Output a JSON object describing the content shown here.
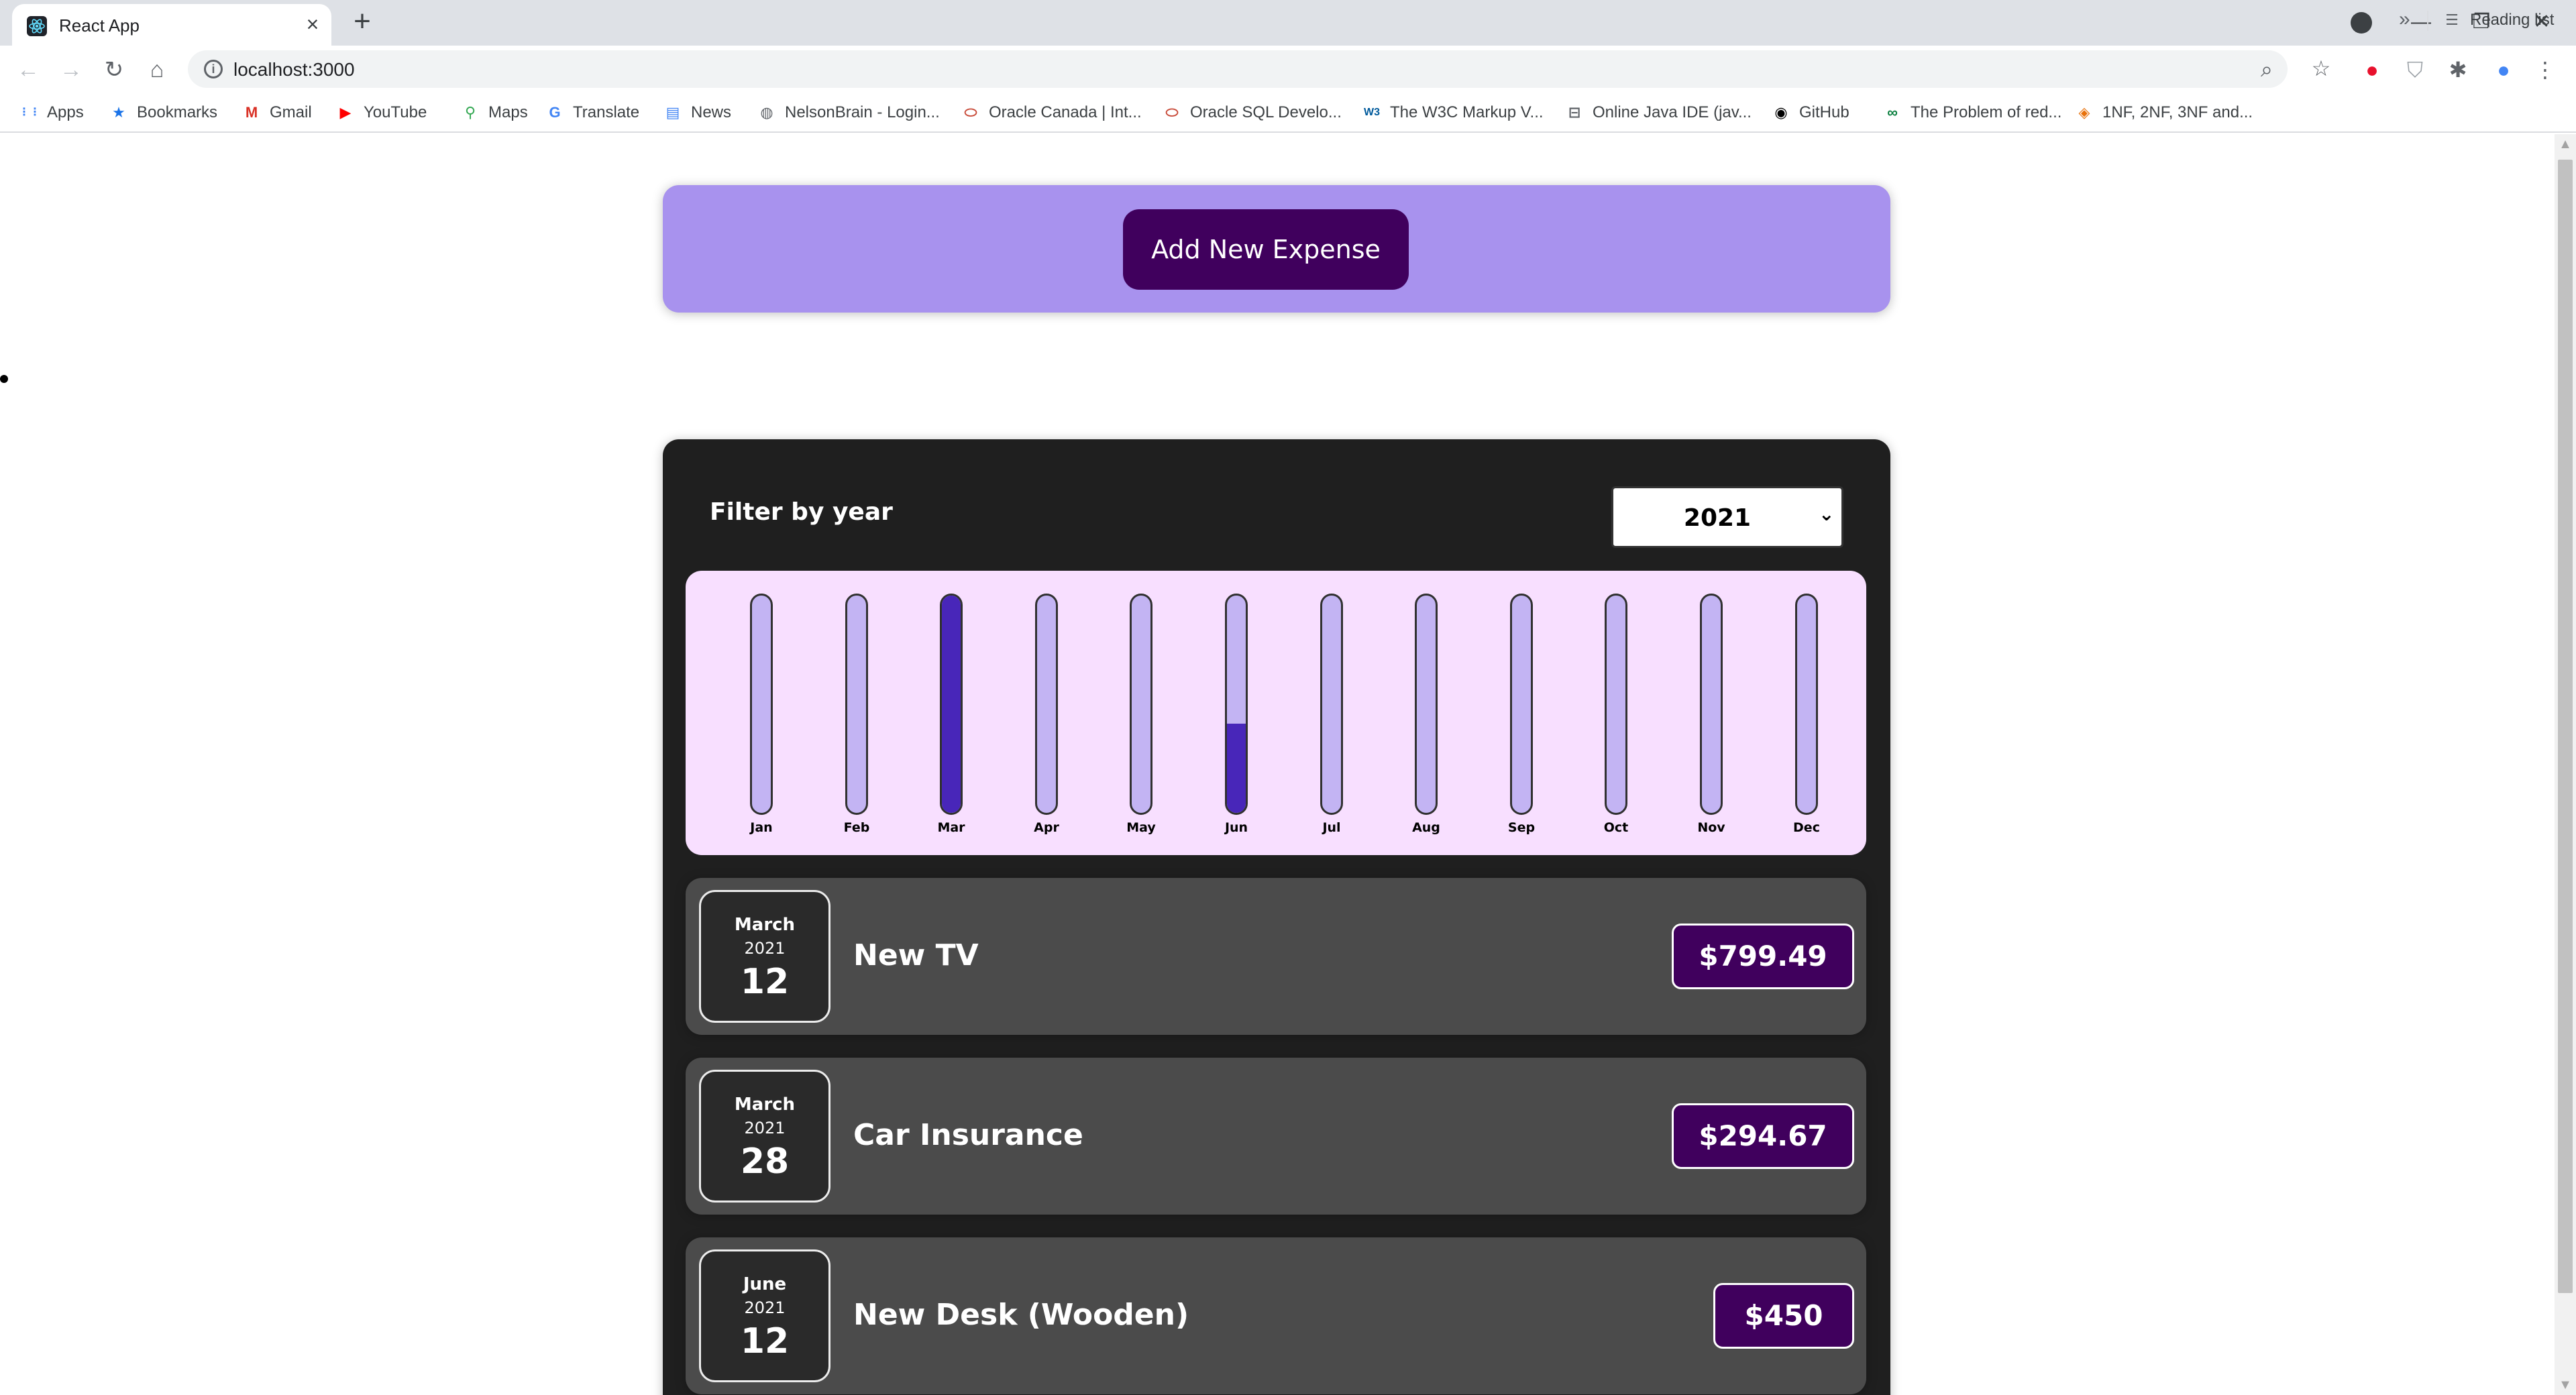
{
  "browser": {
    "tab_title": "React App",
    "url": "localhost:3000",
    "bookmarks": [
      {
        "label": "Apps",
        "icon": "apps-grid-icon",
        "color": "#4285f4"
      },
      {
        "label": "Bookmarks",
        "icon": "star-icon",
        "color": "#1a73e8"
      },
      {
        "label": "Gmail",
        "icon": "gmail-icon",
        "color": "#d93025"
      },
      {
        "label": "YouTube",
        "icon": "youtube-icon",
        "color": "#ff0000"
      },
      {
        "label": "Maps",
        "icon": "maps-pin-icon",
        "color": "#34a853"
      },
      {
        "label": "Translate",
        "icon": "translate-icon",
        "color": "#4285f4"
      },
      {
        "label": "News",
        "icon": "news-icon",
        "color": "#4285f4"
      },
      {
        "label": "NelsonBrain - Login...",
        "icon": "globe-icon",
        "color": "#5f6368"
      },
      {
        "label": "Oracle Canada | Int...",
        "icon": "oracle-icon",
        "color": "#c74634"
      },
      {
        "label": "Oracle SQL Develo...",
        "icon": "oracle-icon",
        "color": "#c74634"
      },
      {
        "label": "The W3C Markup V...",
        "icon": "w3c-icon",
        "color": "#005a9c"
      },
      {
        "label": "Online Java IDE (jav...",
        "icon": "java-icon",
        "color": "#5f6368"
      },
      {
        "label": "GitHub",
        "icon": "github-icon",
        "color": "#000000"
      },
      {
        "label": "The Problem of red...",
        "icon": "link-icon",
        "color": "#0a7f3f"
      },
      {
        "label": "1NF, 2NF, 3NF and...",
        "icon": "site-icon",
        "color": "#e8710a"
      }
    ],
    "reading_list": "Reading list"
  },
  "new_expense": {
    "button_label": "Add New Expense"
  },
  "filter": {
    "label": "Filter by year",
    "selected_year": "2021"
  },
  "chart_data": {
    "type": "bar",
    "categories": [
      "Jan",
      "Feb",
      "Mar",
      "Apr",
      "May",
      "Jun",
      "Jul",
      "Aug",
      "Sep",
      "Oct",
      "Nov",
      "Dec"
    ],
    "values": [
      0,
      0,
      1094.16,
      0,
      0,
      450,
      0,
      0,
      0,
      0,
      0,
      0
    ],
    "max": 1094.16,
    "fill_color": "#4826b9",
    "empty_color": "#c3b4f3"
  },
  "expenses": [
    {
      "month": "March",
      "year": "2021",
      "day": "12",
      "title": "New TV",
      "amount": "$799.49"
    },
    {
      "month": "March",
      "year": "2021",
      "day": "28",
      "title": "Car Insurance",
      "amount": "$294.67"
    },
    {
      "month": "June",
      "year": "2021",
      "day": "12",
      "title": "New Desk (Wooden)",
      "amount": "$450"
    }
  ]
}
